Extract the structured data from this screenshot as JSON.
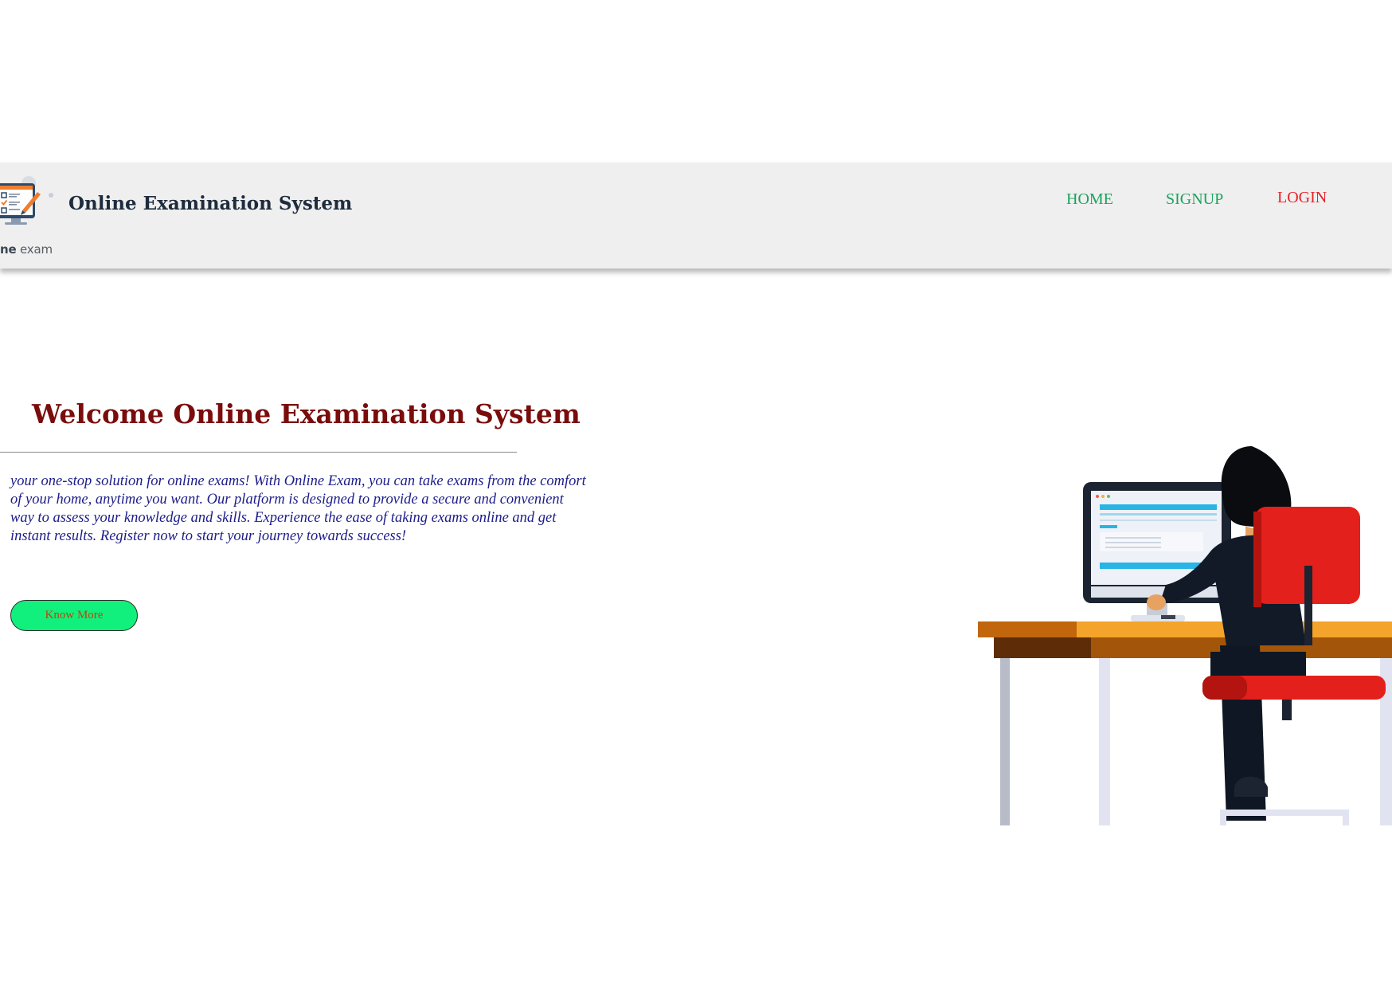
{
  "navbar": {
    "logo_caption_bold": "ne",
    "logo_caption_rest": " exam",
    "brand_title": "Online Examination System",
    "links": [
      {
        "label": "HOME",
        "color": "#1aa35f"
      },
      {
        "label": "SIGNUP",
        "color": "#1aa35f"
      },
      {
        "label": "LOGIN",
        "color": "#e8202a"
      }
    ]
  },
  "hero": {
    "title": "Welcome Online Examination System",
    "title_color": "#7a0c0c",
    "lines": [
      "your one-stop solution for online exams! With Online Exam, you can take exams from the comfort",
      "of your home, anytime you want. Our platform is designed to provide a secure and convenient",
      "way to assess your knowledge and skills. Experience the ease of taking exams online and get",
      "instant results. Register now to start your journey towards success!"
    ],
    "text_color": "#1c1c8a",
    "button_label": "Know More",
    "button_bg": "#11f07c",
    "button_text_color": "#b34a10"
  },
  "illustration": {
    "icon": "person-at-computer-desk-illustration"
  }
}
